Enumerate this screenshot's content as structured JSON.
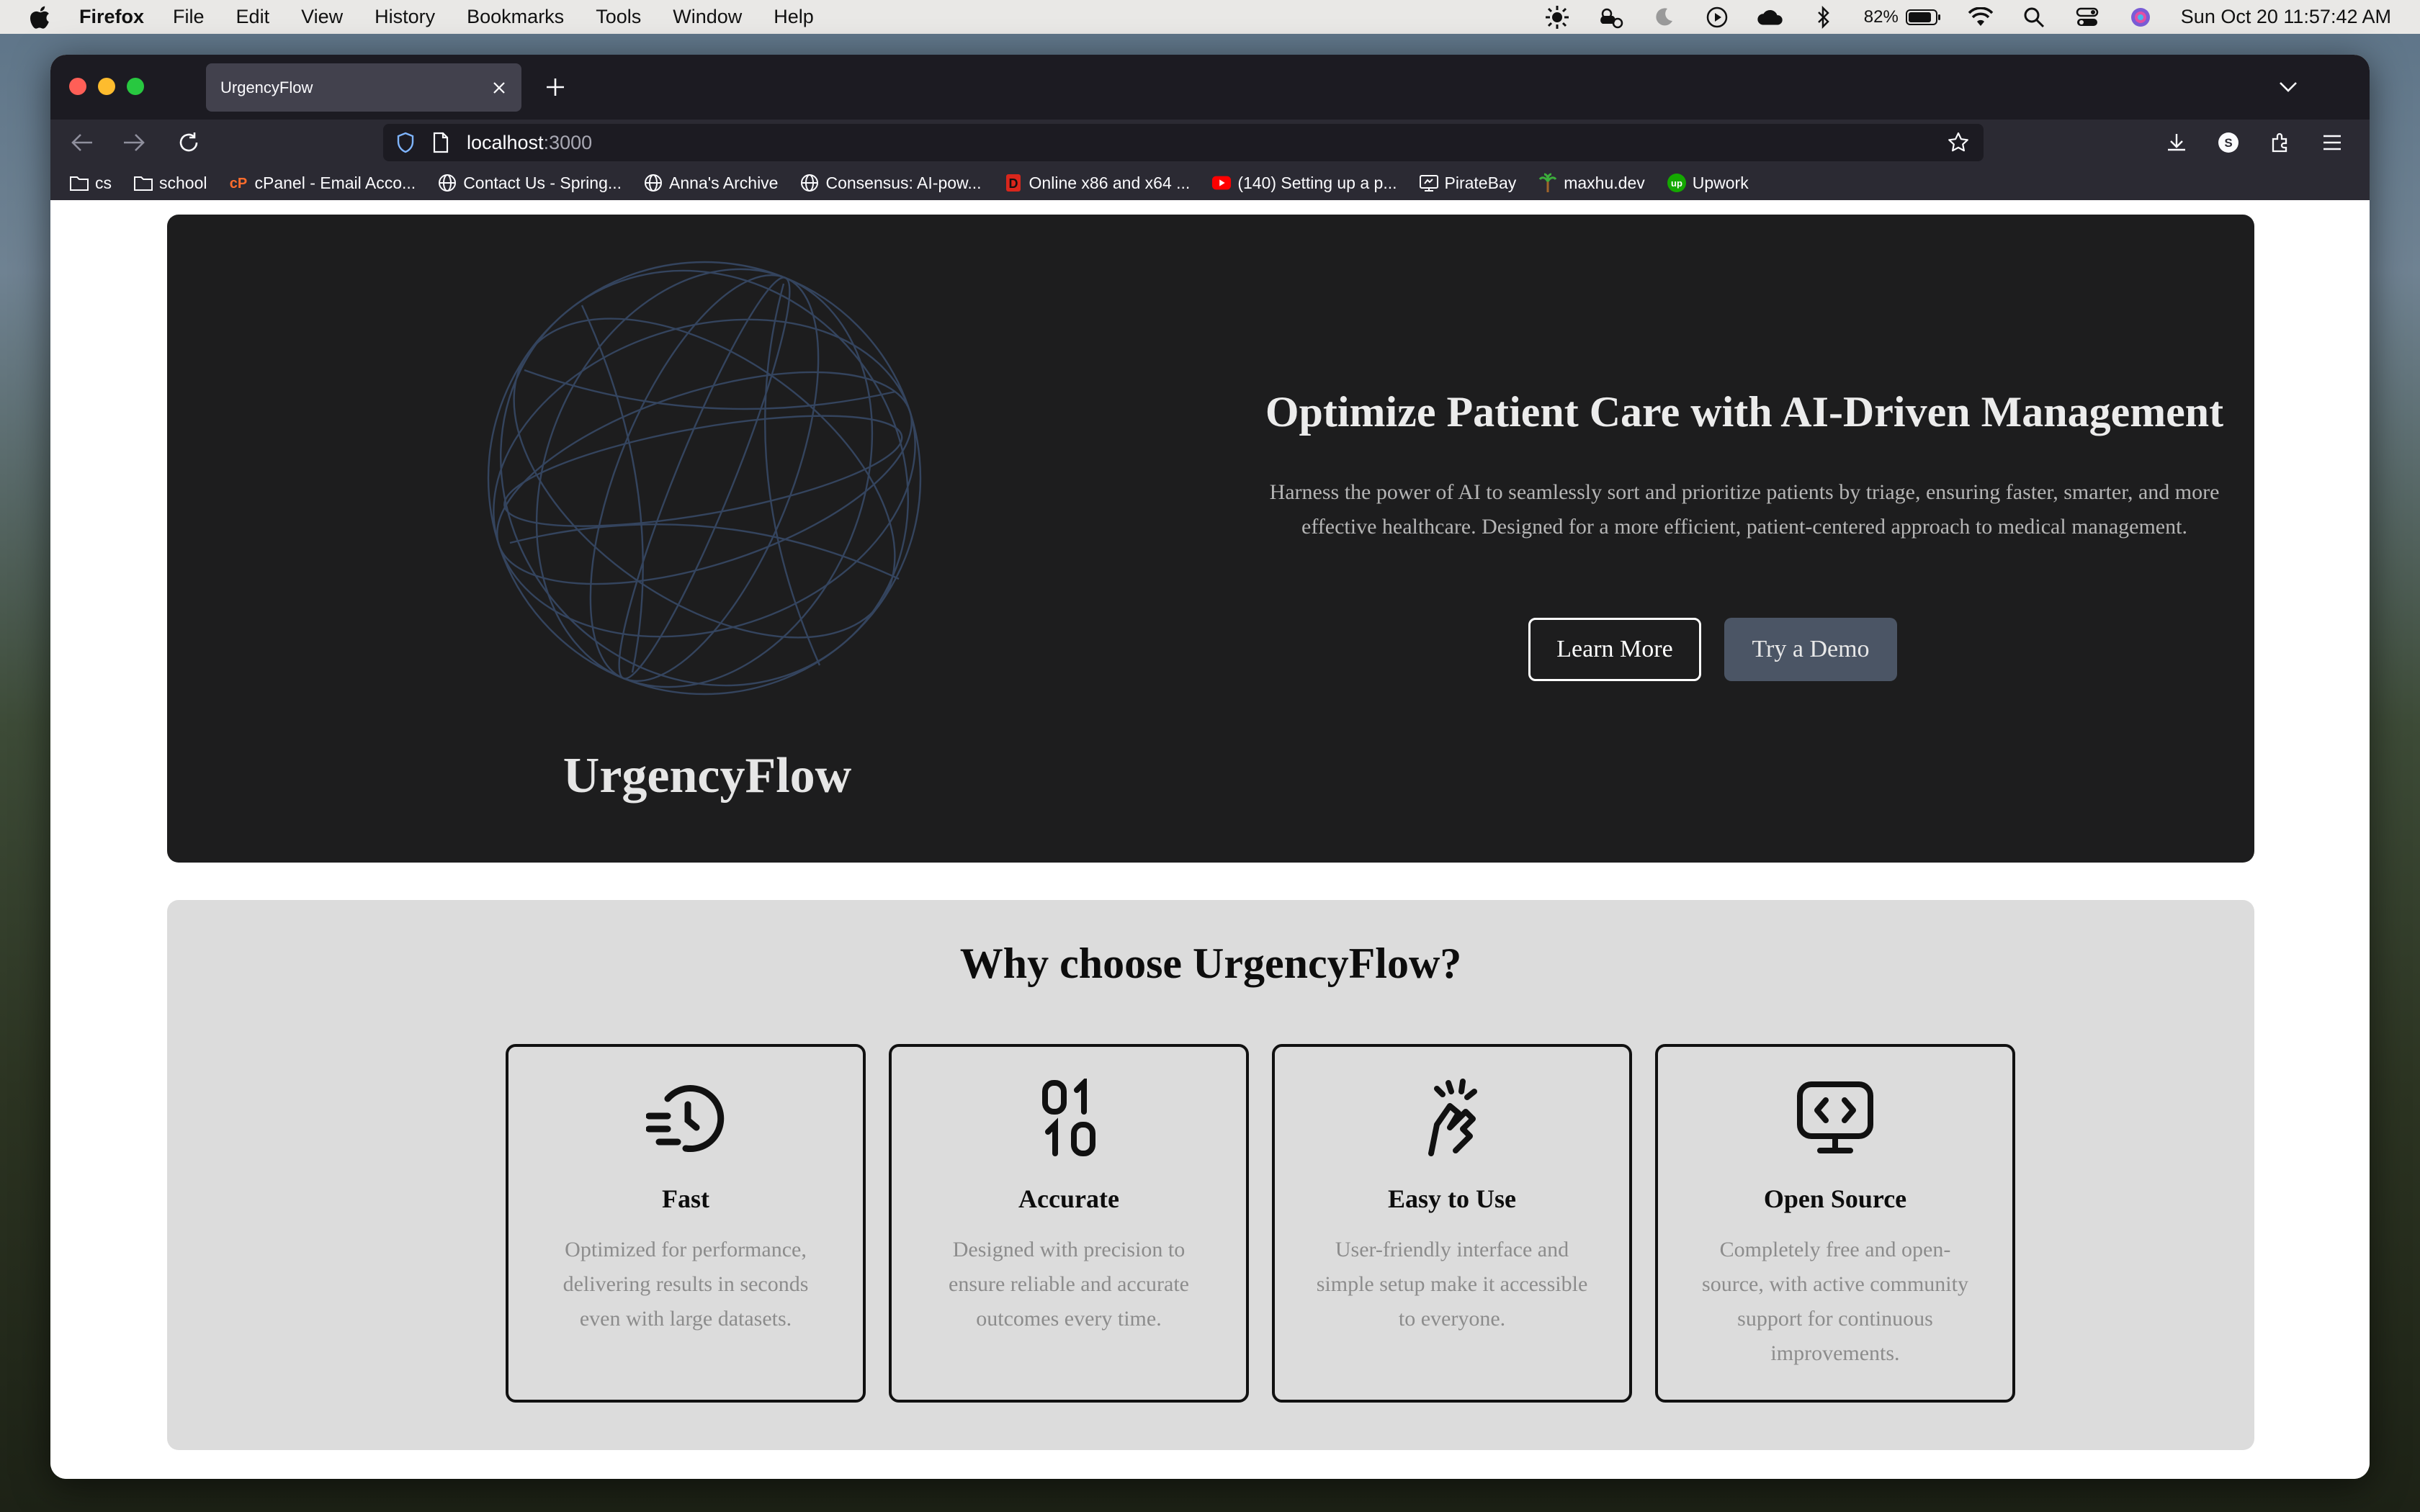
{
  "menubar": {
    "app_name": "Firefox",
    "menus": [
      "File",
      "Edit",
      "View",
      "History",
      "Bookmarks",
      "Tools",
      "Window",
      "Help"
    ],
    "battery_percent": "82%",
    "clock": "Sun Oct 20  11:57:42 AM"
  },
  "browser": {
    "tab_title": "UrgencyFlow",
    "url_host": "localhost",
    "url_port": ":3000",
    "bookmarks": [
      {
        "label": "cs",
        "icon": "folder-icon"
      },
      {
        "label": "school",
        "icon": "folder-icon"
      },
      {
        "label": "cPanel - Email Acco...",
        "icon": "cpanel-icon"
      },
      {
        "label": "Contact Us - Spring...",
        "icon": "globe-icon"
      },
      {
        "label": "Anna's Archive",
        "icon": "globe-icon"
      },
      {
        "label": "Consensus: AI-pow...",
        "icon": "globe-icon"
      },
      {
        "label": "Online x86 and x64 ...",
        "icon": "d-logo-icon"
      },
      {
        "label": "(140) Setting up a p...",
        "icon": "youtube-icon"
      },
      {
        "label": "PirateBay",
        "icon": "piratebay-icon"
      },
      {
        "label": "maxhu.dev",
        "icon": "palm-tree-icon"
      },
      {
        "label": "Upwork",
        "icon": "upwork-icon"
      }
    ]
  },
  "hero": {
    "brand": "UrgencyFlow",
    "title": "Optimize Patient Care with AI-Driven Management",
    "description": "Harness the power of AI to seamlessly sort and prioritize patients by triage, ensuring faster, smarter, and more effective healthcare. Designed for a more efficient, patient-centered approach to medical management.",
    "learn_more": "Learn More",
    "try_demo": "Try a Demo"
  },
  "features": {
    "title": "Why choose UrgencyFlow?",
    "cards": [
      {
        "title": "Fast",
        "description": "Optimized for performance, delivering results in seconds even with large datasets.",
        "icon": "fast-clock-icon"
      },
      {
        "title": "Accurate",
        "description": "Designed with precision to ensure reliable and accurate outcomes every time.",
        "icon": "binary-icon"
      },
      {
        "title": "Easy to Use",
        "description": "User-friendly interface and simple setup make it accessible to everyone.",
        "icon": "tap-hand-icon"
      },
      {
        "title": "Open Source",
        "description": "Completely free and open-source, with active community support for continuous improvements.",
        "icon": "code-monitor-icon"
      }
    ]
  },
  "colors": {
    "hero_bg": "#1d1d1e",
    "features_bg": "#dcdcdc",
    "demo_button_bg": "#4b5565",
    "globe_stroke": "#34445e"
  }
}
